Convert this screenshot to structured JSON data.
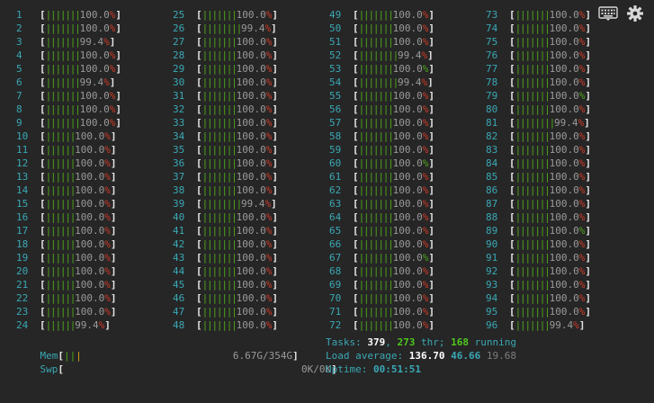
{
  "cpus": [
    {
      "n": "1",
      "bars": "|||||||",
      "pct": "100.0",
      "suf": "%",
      "red": true
    },
    {
      "n": "2",
      "bars": "|||||||",
      "pct": "100.0",
      "suf": "%",
      "red": true
    },
    {
      "n": "3",
      "bars": "|||||||",
      "pct": "99.4",
      "suf": "%",
      "red": true
    },
    {
      "n": "4",
      "bars": "|||||||",
      "pct": "100.0",
      "suf": "%",
      "red": true
    },
    {
      "n": "5",
      "bars": "|||||||",
      "pct": "100.0",
      "suf": "%",
      "red": true
    },
    {
      "n": "6",
      "bars": "|||||||",
      "pct": "99.4",
      "suf": "%",
      "red": true
    },
    {
      "n": "7",
      "bars": "|||||||",
      "pct": "100.0",
      "suf": "%",
      "red": true
    },
    {
      "n": "8",
      "bars": "|||||||",
      "pct": "100.0",
      "suf": "%",
      "red": true
    },
    {
      "n": "9",
      "bars": "|||||||",
      "pct": "100.0",
      "suf": "%",
      "red": true
    },
    {
      "n": "10",
      "bars": "||||||",
      "pct": "100.0",
      "suf": "%",
      "red": true
    },
    {
      "n": "11",
      "bars": "||||||",
      "pct": "100.0",
      "suf": "%",
      "red": true
    },
    {
      "n": "12",
      "bars": "||||||",
      "pct": "100.0",
      "suf": "%",
      "red": true
    },
    {
      "n": "13",
      "bars": "||||||",
      "pct": "100.0",
      "suf": "%",
      "red": true
    },
    {
      "n": "14",
      "bars": "||||||",
      "pct": "100.0",
      "suf": "%",
      "red": true
    },
    {
      "n": "15",
      "bars": "||||||",
      "pct": "100.0",
      "suf": "%",
      "red": true
    },
    {
      "n": "16",
      "bars": "||||||",
      "pct": "100.0",
      "suf": "%",
      "red": true
    },
    {
      "n": "17",
      "bars": "||||||",
      "pct": "100.0",
      "suf": "%",
      "red": true
    },
    {
      "n": "18",
      "bars": "||||||",
      "pct": "100.0",
      "suf": "%",
      "red": true
    },
    {
      "n": "19",
      "bars": "||||||",
      "pct": "100.0",
      "suf": "%",
      "red": true
    },
    {
      "n": "20",
      "bars": "||||||",
      "pct": "100.0",
      "suf": "%",
      "red": true
    },
    {
      "n": "21",
      "bars": "||||||",
      "pct": "100.0",
      "suf": "%",
      "red": true
    },
    {
      "n": "22",
      "bars": "||||||",
      "pct": "100.0",
      "suf": "%",
      "red": true
    },
    {
      "n": "23",
      "bars": "||||||",
      "pct": "100.0",
      "suf": "%",
      "red": true
    },
    {
      "n": "24",
      "bars": "||||||",
      "pct": "99.4",
      "suf": "%",
      "red": true
    },
    {
      "n": "25",
      "bars": "|||||||",
      "pct": "100.0",
      "suf": "%",
      "red": true
    },
    {
      "n": "26",
      "bars": "||||||||",
      "pct": "99.4",
      "suf": "%",
      "red": true
    },
    {
      "n": "27",
      "bars": "|||||||",
      "pct": "100.0",
      "suf": "%",
      "red": true
    },
    {
      "n": "28",
      "bars": "|||||||",
      "pct": "100.0",
      "suf": "%",
      "red": true
    },
    {
      "n": "29",
      "bars": "|||||||",
      "pct": "100.0",
      "suf": "%",
      "red": true
    },
    {
      "n": "30",
      "bars": "|||||||",
      "pct": "100.0",
      "suf": "%",
      "red": true
    },
    {
      "n": "31",
      "bars": "|||||||",
      "pct": "100.0",
      "suf": "%",
      "red": true
    },
    {
      "n": "32",
      "bars": "|||||||",
      "pct": "100.0",
      "suf": "%",
      "red": true
    },
    {
      "n": "33",
      "bars": "|||||||",
      "pct": "100.0",
      "suf": "%",
      "red": true
    },
    {
      "n": "34",
      "bars": "|||||||",
      "pct": "100.0",
      "suf": "%",
      "red": true
    },
    {
      "n": "35",
      "bars": "|||||||",
      "pct": "100.0",
      "suf": "%",
      "red": true
    },
    {
      "n": "36",
      "bars": "|||||||",
      "pct": "100.0",
      "suf": "%",
      "red": true
    },
    {
      "n": "37",
      "bars": "|||||||",
      "pct": "100.0",
      "suf": "%",
      "red": true
    },
    {
      "n": "38",
      "bars": "|||||||",
      "pct": "100.0",
      "suf": "%",
      "red": true
    },
    {
      "n": "39",
      "bars": "||||||||",
      "pct": "99.4",
      "suf": "%",
      "red": true
    },
    {
      "n": "40",
      "bars": "|||||||",
      "pct": "100.0",
      "suf": "%",
      "red": true
    },
    {
      "n": "41",
      "bars": "|||||||",
      "pct": "100.0",
      "suf": "%",
      "red": true
    },
    {
      "n": "42",
      "bars": "|||||||",
      "pct": "100.0",
      "suf": "%",
      "red": true
    },
    {
      "n": "43",
      "bars": "|||||||",
      "pct": "100.0",
      "suf": "%",
      "red": true
    },
    {
      "n": "44",
      "bars": "|||||||",
      "pct": "100.0",
      "suf": "%",
      "red": true
    },
    {
      "n": "45",
      "bars": "|||||||",
      "pct": "100.0",
      "suf": "%",
      "red": true
    },
    {
      "n": "46",
      "bars": "|||||||",
      "pct": "100.0",
      "suf": "%",
      "red": true
    },
    {
      "n": "47",
      "bars": "|||||||",
      "pct": "100.0",
      "suf": "%",
      "red": true
    },
    {
      "n": "48",
      "bars": "|||||||",
      "pct": "100.0",
      "suf": "%",
      "red": true
    },
    {
      "n": "49",
      "bars": "|||||||",
      "pct": "100.0",
      "suf": "%",
      "red": true
    },
    {
      "n": "50",
      "bars": "|||||||",
      "pct": "100.0",
      "suf": "%",
      "red": true
    },
    {
      "n": "51",
      "bars": "|||||||",
      "pct": "100.0",
      "suf": "%",
      "red": true
    },
    {
      "n": "52",
      "bars": "||||||||",
      "pct": "99.4",
      "suf": "%",
      "red": true
    },
    {
      "n": "53",
      "bars": "|||||||",
      "pct": "100.0",
      "suf": "%",
      "red": false
    },
    {
      "n": "54",
      "bars": "||||||||",
      "pct": "99.4",
      "suf": "%",
      "red": true
    },
    {
      "n": "55",
      "bars": "|||||||",
      "pct": "100.0",
      "suf": "%",
      "red": true
    },
    {
      "n": "56",
      "bars": "|||||||",
      "pct": "100.0",
      "suf": "%",
      "red": true
    },
    {
      "n": "57",
      "bars": "|||||||",
      "pct": "100.0",
      "suf": "%",
      "red": true
    },
    {
      "n": "58",
      "bars": "|||||||",
      "pct": "100.0",
      "suf": "%",
      "red": true
    },
    {
      "n": "59",
      "bars": "|||||||",
      "pct": "100.0",
      "suf": "%",
      "red": true
    },
    {
      "n": "60",
      "bars": "|||||||",
      "pct": "100.0",
      "suf": "%",
      "red": false
    },
    {
      "n": "61",
      "bars": "|||||||",
      "pct": "100.0",
      "suf": "%",
      "red": true
    },
    {
      "n": "62",
      "bars": "|||||||",
      "pct": "100.0",
      "suf": "%",
      "red": true
    },
    {
      "n": "63",
      "bars": "|||||||",
      "pct": "100.0",
      "suf": "%",
      "red": true
    },
    {
      "n": "64",
      "bars": "|||||||",
      "pct": "100.0",
      "suf": "%",
      "red": true
    },
    {
      "n": "65",
      "bars": "|||||||",
      "pct": "100.0",
      "suf": "%",
      "red": true
    },
    {
      "n": "66",
      "bars": "|||||||",
      "pct": "100.0",
      "suf": "%",
      "red": true
    },
    {
      "n": "67",
      "bars": "|||||||",
      "pct": "100.0",
      "suf": "%",
      "red": false
    },
    {
      "n": "68",
      "bars": "|||||||",
      "pct": "100.0",
      "suf": "%",
      "red": true
    },
    {
      "n": "69",
      "bars": "|||||||",
      "pct": "100.0",
      "suf": "%",
      "red": true
    },
    {
      "n": "70",
      "bars": "|||||||",
      "pct": "100.0",
      "suf": "%",
      "red": true
    },
    {
      "n": "71",
      "bars": "|||||||",
      "pct": "100.0",
      "suf": "%",
      "red": true
    },
    {
      "n": "72",
      "bars": "|||||||",
      "pct": "100.0",
      "suf": "%",
      "red": true
    },
    {
      "n": "73",
      "bars": "|||||||",
      "pct": "100.0",
      "suf": "%",
      "red": true
    },
    {
      "n": "74",
      "bars": "|||||||",
      "pct": "100.0",
      "suf": "%",
      "red": true
    },
    {
      "n": "75",
      "bars": "|||||||",
      "pct": "100.0",
      "suf": "%",
      "red": true
    },
    {
      "n": "76",
      "bars": "|||||||",
      "pct": "100.0",
      "suf": "%",
      "red": true
    },
    {
      "n": "77",
      "bars": "|||||||",
      "pct": "100.0",
      "suf": "%",
      "red": true
    },
    {
      "n": "78",
      "bars": "|||||||",
      "pct": "100.0",
      "suf": "%",
      "red": true
    },
    {
      "n": "79",
      "bars": "|||||||",
      "pct": "100.0",
      "suf": "%",
      "red": false
    },
    {
      "n": "80",
      "bars": "|||||||",
      "pct": "100.0",
      "suf": "%",
      "red": true
    },
    {
      "n": "81",
      "bars": "||||||||",
      "pct": "99.4",
      "suf": "%",
      "red": true
    },
    {
      "n": "82",
      "bars": "|||||||",
      "pct": "100.0",
      "suf": "%",
      "red": true
    },
    {
      "n": "83",
      "bars": "|||||||",
      "pct": "100.0",
      "suf": "%",
      "red": true
    },
    {
      "n": "84",
      "bars": "|||||||",
      "pct": "100.0",
      "suf": "%",
      "red": true
    },
    {
      "n": "85",
      "bars": "|||||||",
      "pct": "100.0",
      "suf": "%",
      "red": true
    },
    {
      "n": "86",
      "bars": "|||||||",
      "pct": "100.0",
      "suf": "%",
      "red": true
    },
    {
      "n": "87",
      "bars": "|||||||",
      "pct": "100.0",
      "suf": "%",
      "red": true
    },
    {
      "n": "88",
      "bars": "|||||||",
      "pct": "100.0",
      "suf": "%",
      "red": true
    },
    {
      "n": "89",
      "bars": "|||||||",
      "pct": "100.0",
      "suf": "%",
      "red": false
    },
    {
      "n": "90",
      "bars": "|||||||",
      "pct": "100.0",
      "suf": "%",
      "red": true
    },
    {
      "n": "91",
      "bars": "|||||||",
      "pct": "100.0",
      "suf": "%",
      "red": true
    },
    {
      "n": "92",
      "bars": "|||||||",
      "pct": "100.0",
      "suf": "%",
      "red": true
    },
    {
      "n": "93",
      "bars": "|||||||",
      "pct": "100.0",
      "suf": "%",
      "red": true
    },
    {
      "n": "94",
      "bars": "|||||||",
      "pct": "100.0",
      "suf": "%",
      "red": true
    },
    {
      "n": "95",
      "bars": "|||||||",
      "pct": "100.0",
      "suf": "%",
      "red": true
    },
    {
      "n": "96",
      "bars": "|||||||",
      "pct": "99.4",
      "suf": "%",
      "red": true
    }
  ],
  "mem": {
    "label": "Mem",
    "bars": "||",
    "bar2": "|",
    "value": "6.67G/354G"
  },
  "swp": {
    "label": "Swp",
    "value": "0K/0K"
  },
  "tasks": {
    "label": "Tasks: ",
    "count": "379",
    "sep": ", ",
    "thr": "273",
    "thr_label": " thr; ",
    "running": "168",
    "running_label": " running"
  },
  "load": {
    "label": "Load average: ",
    "l1": "136.70",
    "l5": "46.66",
    "l15": "19.68"
  },
  "uptime": {
    "label": "Uptime: ",
    "value": "00:51:51"
  },
  "bracket_open": "[",
  "bracket_close": "]",
  "colors": {
    "bg": "#262626",
    "cpu_num": "#3aa8b5",
    "bar_green": "#4ea51a",
    "percent_red": "#cf3b28"
  },
  "toolbar": {
    "keyboard": "keyboard-icon",
    "settings": "gear-icon"
  }
}
